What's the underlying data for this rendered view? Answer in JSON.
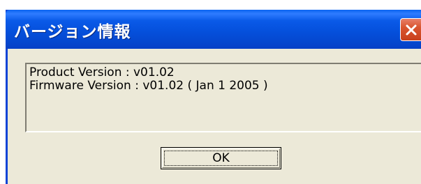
{
  "window": {
    "title": "バージョン情報",
    "close_icon": "close-x-icon"
  },
  "info": {
    "product_version": "Product Version : v01.02",
    "firmware_version": "Firmware Version : v01.02 ( Jan 1 2005 )"
  },
  "buttons": {
    "ok_label": "OK"
  },
  "colors": {
    "titlebar": "#0550dc",
    "client_background": "#ece9d8",
    "close_button": "#d9552f",
    "text": "#000000"
  }
}
